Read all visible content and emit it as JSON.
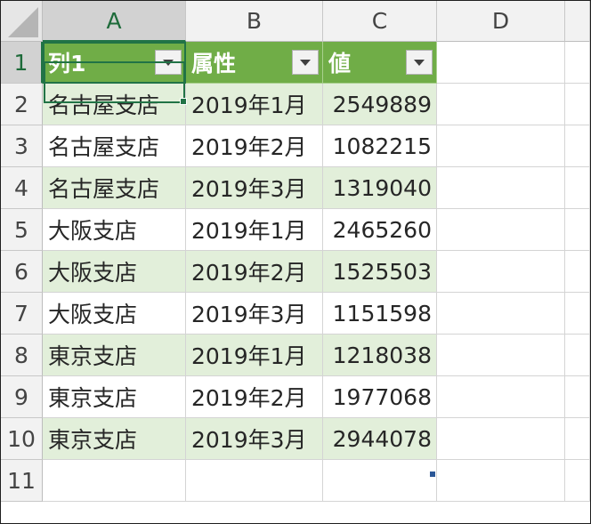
{
  "columns": [
    "A",
    "B",
    "C",
    "D"
  ],
  "rows": [
    "1",
    "2",
    "3",
    "4",
    "5",
    "6",
    "7",
    "8",
    "9",
    "10",
    "11"
  ],
  "table": {
    "headers": [
      "列1",
      "属性",
      "値"
    ],
    "data": [
      [
        "名古屋支店",
        "2019年1月",
        "2549889"
      ],
      [
        "名古屋支店",
        "2019年2月",
        "1082215"
      ],
      [
        "名古屋支店",
        "2019年3月",
        "1319040"
      ],
      [
        "大阪支店",
        "2019年1月",
        "2465260"
      ],
      [
        "大阪支店",
        "2019年2月",
        "1525503"
      ],
      [
        "大阪支店",
        "2019年3月",
        "1151598"
      ],
      [
        "東京支店",
        "2019年1月",
        "1218038"
      ],
      [
        "東京支店",
        "2019年2月",
        "1977068"
      ],
      [
        "東京支店",
        "2019年3月",
        "2944078"
      ]
    ]
  },
  "selected_cell": "A1",
  "colors": {
    "header_fill": "#70ad47",
    "band_fill": "#e2efda",
    "selection": "#217346"
  }
}
